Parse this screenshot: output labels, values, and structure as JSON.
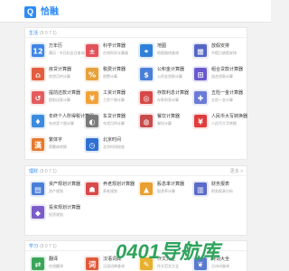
{
  "header": {
    "logo_char": "Q",
    "title": "恰融"
  },
  "sections": [
    {
      "title": "生活",
      "subtitle": "(9 0 7 1)",
      "more": "",
      "tools": [
        {
          "name": "万年历",
          "desc": "黄历 · 节日纪念日查询",
          "icon": "calendar-icon",
          "color": "#3f86e6"
        },
        {
          "name": "科学计算器",
          "desc": "在线科学计算器",
          "icon": "calculator-icon",
          "color": "#e2525a"
        },
        {
          "name": "地图",
          "desc": "地图路线查询",
          "icon": "map-icon",
          "color": "#2f80d8"
        },
        {
          "name": "放假安排",
          "desc": "节假日放假安排",
          "icon": "schedule-icon",
          "color": "#5565c4"
        },
        {
          "name": "房贷计算器",
          "desc": "房贷月供计算",
          "icon": "house-calculator-icon",
          "color": "#e35d3f"
        },
        {
          "name": "税费计算器",
          "desc": "税费计算",
          "icon": "tax-calculator-icon",
          "color": "#e6a23c"
        },
        {
          "name": "公积金计算器",
          "desc": "公积金贷款计算",
          "icon": "fund-calculator-icon",
          "color": "#4a7fd9"
        },
        {
          "name": "组合贷款计算器",
          "desc": "组合贷款计算",
          "icon": "combo-loan-icon",
          "color": "#6a5acd"
        },
        {
          "name": "提前还款计算器",
          "desc": "提前还款计算",
          "icon": "prepay-calculator-icon",
          "color": "#e45c5c"
        },
        {
          "name": "工资计算器",
          "desc": "工资个税计算",
          "icon": "salary-calculator-icon",
          "color": "#f0a33a"
        },
        {
          "name": "存款利息计算器",
          "desc": "存款利息计算",
          "icon": "deposit-calculator-icon",
          "color": "#d64848"
        },
        {
          "name": "五险一金计算器",
          "desc": "五险一金计算",
          "icon": "insurance-calculator-icon",
          "color": "#6b7bd6"
        },
        {
          "name": "年终个人所得税计算器",
          "desc": "年终奖个税计算",
          "icon": "annual-tax-icon",
          "color": "#3c8be0"
        },
        {
          "name": "车贷计算器",
          "desc": "车贷月供计算",
          "icon": "car-loan-icon",
          "color": "#7a7a7a"
        },
        {
          "name": "餐饮计算器",
          "desc": "餐饮计算",
          "icon": "dining-calculator-icon",
          "color": "#c84a4a"
        },
        {
          "name": "人民币大写转换器",
          "desc": "人民币大写转换",
          "icon": "rmb-icon",
          "color": "#e03c3c"
        },
        {
          "name": "繁体字",
          "desc": "简繁体转换",
          "icon": "traditional-chinese-icon",
          "color": "#e57a2e"
        },
        {
          "name": "北京时间",
          "desc": "北京时间校准",
          "icon": "clock-icon",
          "color": "#2f6fd0"
        }
      ]
    },
    {
      "title": "理财",
      "subtitle": "(9 0 7 1)",
      "more": "更多 >",
      "tools": [
        {
          "name": "资产规划计算器",
          "desc": "资产规划",
          "icon": "asset-planning-icon",
          "color": "#4a7fd9"
        },
        {
          "name": "养老规划计算器",
          "desc": "养老规划",
          "icon": "retirement-planning-icon",
          "color": "#d84a4a"
        },
        {
          "name": "股息率计算器",
          "desc": "股息率计算",
          "icon": "dividend-calculator-icon",
          "color": "#e8a030"
        },
        {
          "name": "财务报表",
          "desc": "财务报表分析",
          "icon": "financial-report-icon",
          "color": "#5a6ac8"
        },
        {
          "name": "投资规划计算器",
          "desc": "投资规划",
          "icon": "investment-planning-icon",
          "color": "#7b5cc9"
        }
      ]
    },
    {
      "title": "学习",
      "subtitle": "(9 0 7 1)",
      "more": "",
      "tools": [
        {
          "name": "翻译",
          "desc": "在线翻译",
          "icon": "translate-icon",
          "color": "#3aa55a"
        },
        {
          "name": "汉语词典",
          "desc": "汉语词典查询",
          "icon": "dictionary-icon",
          "color": "#e05a3a"
        },
        {
          "name": "作文大全",
          "desc": "作文范文大全",
          "icon": "essay-icon",
          "color": "#e8b030"
        },
        {
          "name": "诗词大全",
          "desc": "古诗词查询",
          "icon": "poetry-icon",
          "color": "#5a7ad0"
        }
      ]
    }
  ],
  "watermark": {
    "text": "0401导航库",
    "color": "#2fa35c"
  }
}
